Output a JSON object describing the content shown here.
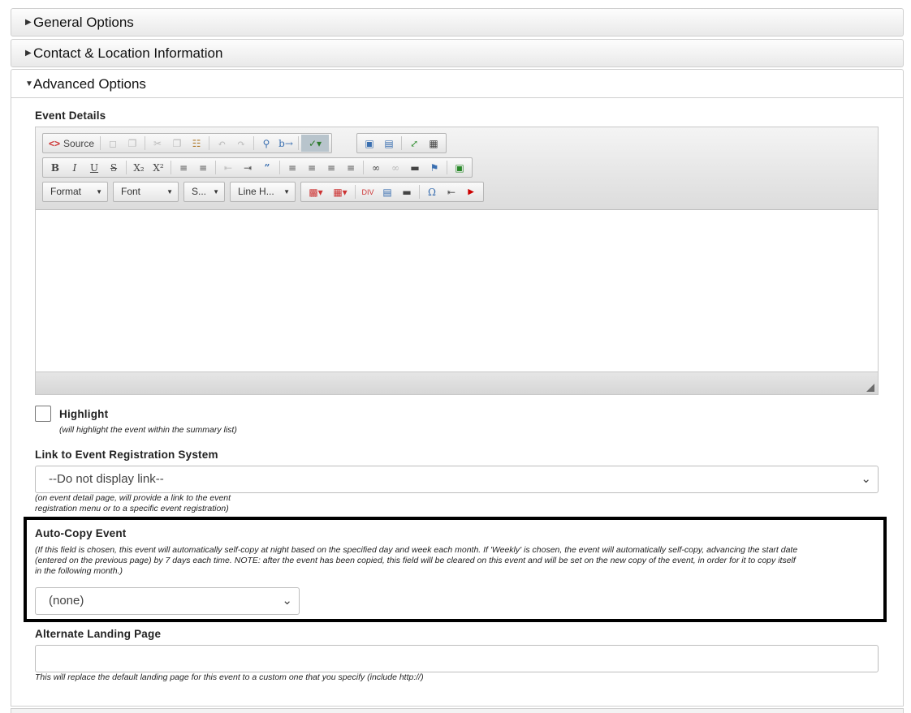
{
  "accordion": {
    "general": "General Options",
    "contact": "Contact & Location Information",
    "advanced": "Advanced Options"
  },
  "event_details": {
    "label": "Event Details",
    "source_label": "Source",
    "combos": {
      "format": "Format",
      "font": "Font",
      "size": "S...",
      "line_height": "Line H..."
    }
  },
  "highlight": {
    "label": "Highlight",
    "note": "(will highlight the event within the summary list)",
    "checked": false
  },
  "registration": {
    "label": "Link to Event Registration System",
    "selected": "--Do not display link--",
    "note_line1": "(on event detail page, will provide a link to the event",
    "note_line2": "registration menu or to a specific event registration)"
  },
  "auto_copy": {
    "label": "Auto-Copy Event",
    "note_line1": "(If this field is chosen, this event will automatically self-copy at night based on the specified day and week each month. If 'Weekly' is chosen, the event will automatically self-copy, advancing the start date",
    "note_line2": "(entered on the previous page) by 7 days each time. NOTE: after the event has been copied, this field will be cleared on this event and will be set on the new copy of the event, in order for it to copy itself",
    "note_line3": "in the following month.)",
    "selected": "(none)"
  },
  "landing": {
    "label": "Alternate Landing Page",
    "value": "",
    "note": "This will replace the default landing page for this event to a custom one that you specify (include http://)"
  }
}
